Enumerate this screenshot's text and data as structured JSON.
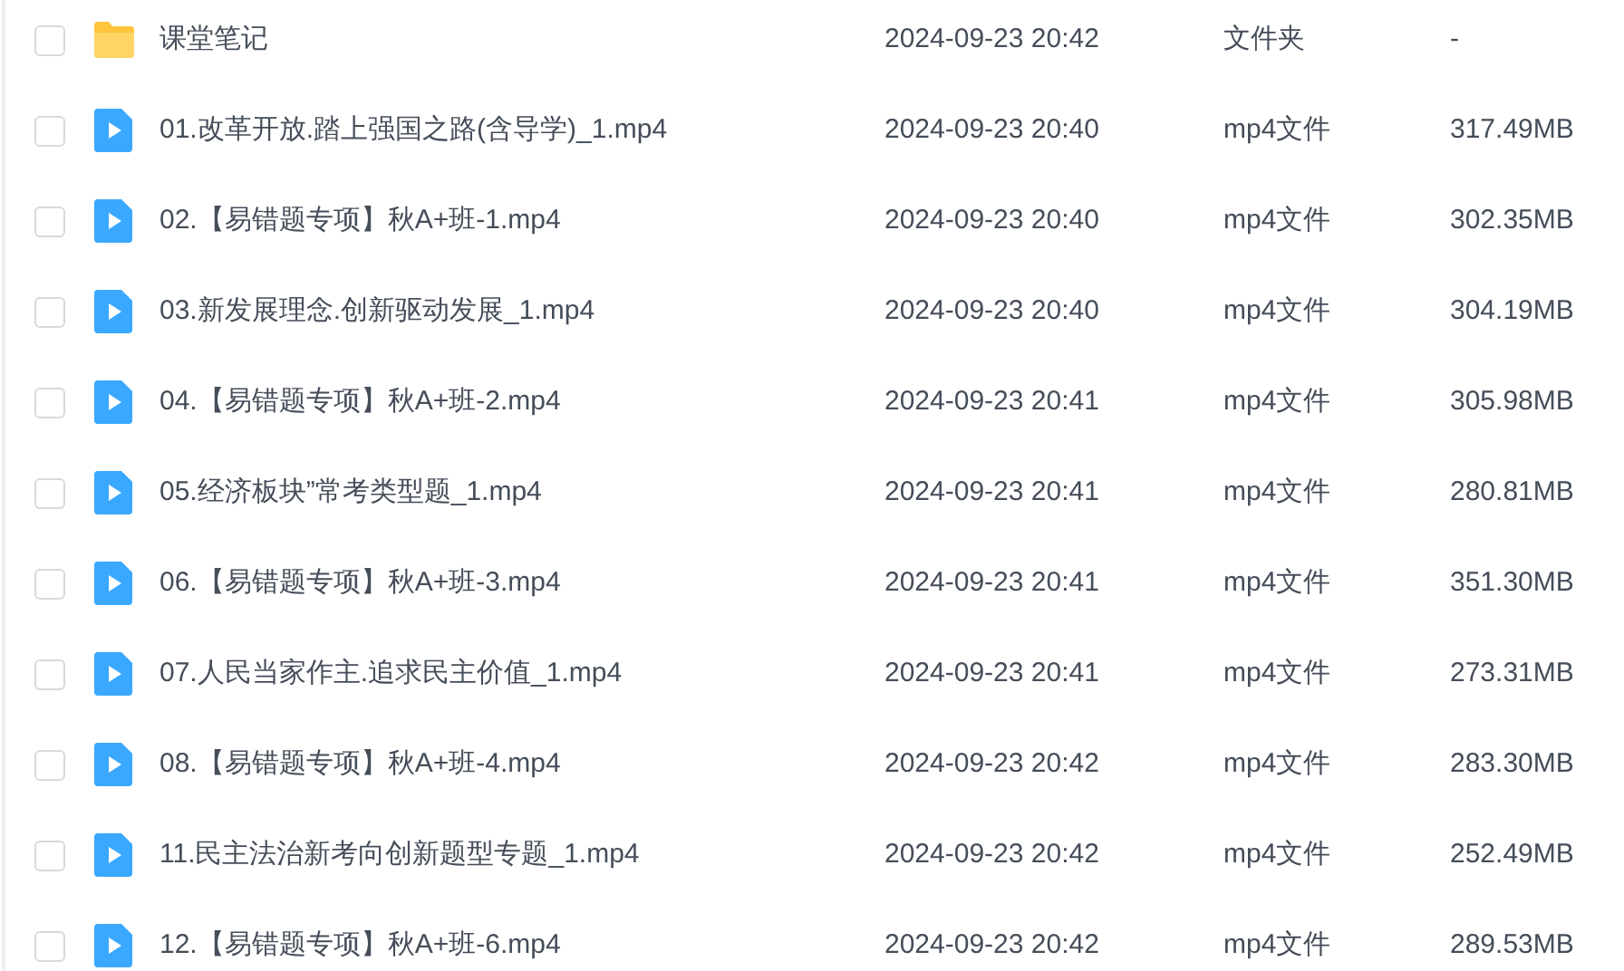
{
  "files": [
    {
      "kind": "folder",
      "name": "课堂笔记",
      "modified": "2024-09-23 20:42",
      "type": "文件夹",
      "size": "-",
      "checked": false
    },
    {
      "kind": "video",
      "name": "01.改革开放.踏上强国之路(含导学)_1.mp4",
      "modified": "2024-09-23 20:40",
      "type": "mp4文件",
      "size": "317.49MB",
      "checked": false
    },
    {
      "kind": "video",
      "name": "02.【易错题专项】秋A+班-1.mp4",
      "modified": "2024-09-23 20:40",
      "type": "mp4文件",
      "size": "302.35MB",
      "checked": false
    },
    {
      "kind": "video",
      "name": "03.新发展理念.创新驱动发展_1.mp4",
      "modified": "2024-09-23 20:40",
      "type": "mp4文件",
      "size": "304.19MB",
      "checked": false
    },
    {
      "kind": "video",
      "name": "04.【易错题专项】秋A+班-2.mp4",
      "modified": "2024-09-23 20:41",
      "type": "mp4文件",
      "size": "305.98MB",
      "checked": false
    },
    {
      "kind": "video",
      "name": "05.经济板块”常考类型题_1.mp4",
      "modified": "2024-09-23 20:41",
      "type": "mp4文件",
      "size": "280.81MB",
      "checked": false
    },
    {
      "kind": "video",
      "name": "06.【易错题专项】秋A+班-3.mp4",
      "modified": "2024-09-23 20:41",
      "type": "mp4文件",
      "size": "351.30MB",
      "checked": false
    },
    {
      "kind": "video",
      "name": "07.人民当家作主.追求民主价值_1.mp4",
      "modified": "2024-09-23 20:41",
      "type": "mp4文件",
      "size": "273.31MB",
      "checked": false
    },
    {
      "kind": "video",
      "name": "08.【易错题专项】秋A+班-4.mp4",
      "modified": "2024-09-23 20:42",
      "type": "mp4文件",
      "size": "283.30MB",
      "checked": false
    },
    {
      "kind": "video",
      "name": "11.民主法治新考向创新题型专题_1.mp4",
      "modified": "2024-09-23 20:42",
      "type": "mp4文件",
      "size": "252.49MB",
      "checked": false
    },
    {
      "kind": "video",
      "name": "12.【易错题专项】秋A+班-6.mp4",
      "modified": "2024-09-23 20:42",
      "type": "mp4文件",
      "size": "289.53MB",
      "checked": false
    }
  ]
}
